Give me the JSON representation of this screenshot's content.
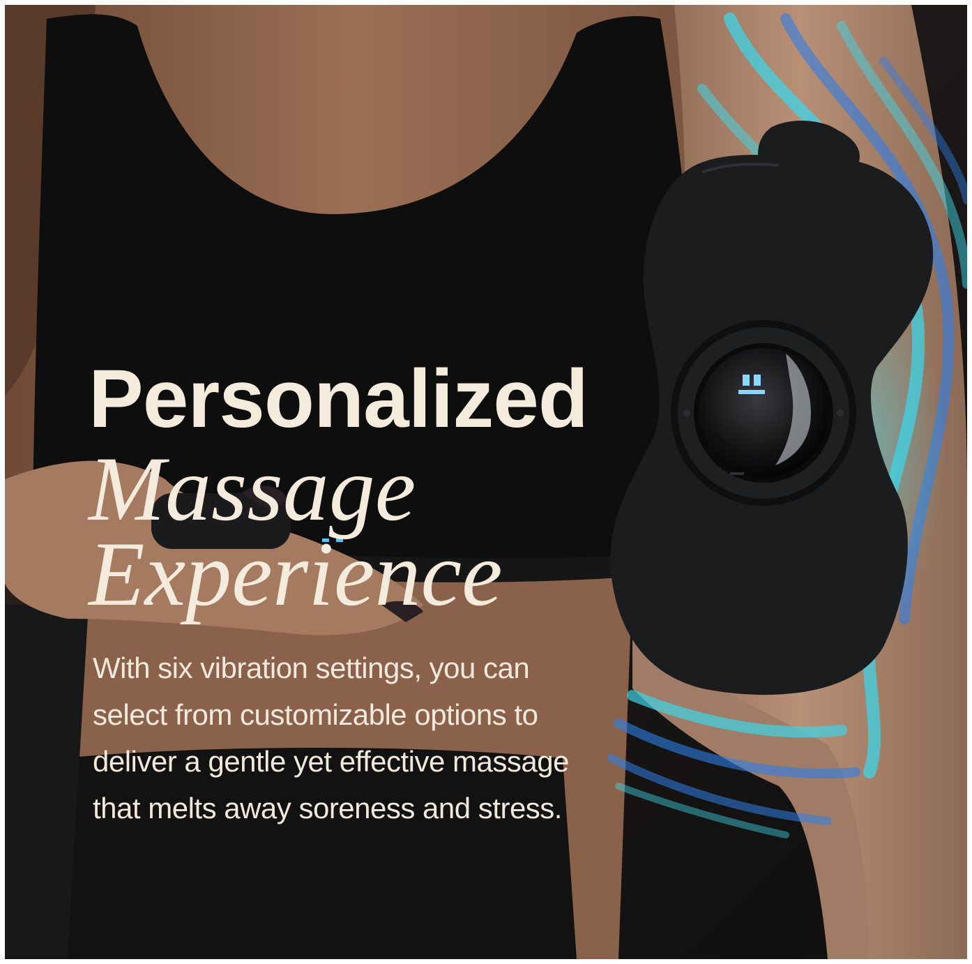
{
  "promo": {
    "heading_line1": "Personalized",
    "heading_line2": "Massage",
    "heading_line3": "Experience",
    "body": "With six vibration settings, you can select from customizable options to deliver a gentle yet effective massage that melts away soreness and stress."
  },
  "colors": {
    "heading_text": "#f4ebdd",
    "body_text": "#f1e9dc",
    "background_dark": "#1a1716",
    "wave_light": "#3fd3e6",
    "wave_blue": "#2f7fe8"
  },
  "icons": {
    "device": "massager-pad-icon"
  }
}
